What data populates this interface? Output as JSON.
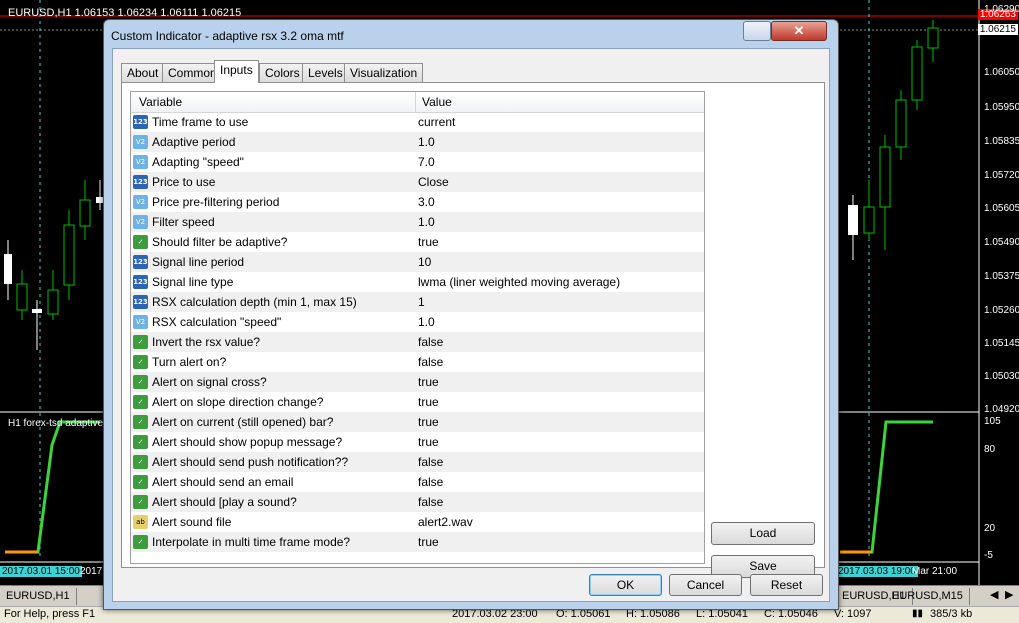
{
  "chart": {
    "symbol_info": "EURUSD,H1  1.06153 1.06234 1.06111 1.06215",
    "subwindow_label": "H1 forex-tsd adaptive",
    "price_axis": [
      "1.06290",
      "1.06215",
      "1.06050",
      "1.05950",
      "1.05835",
      "1.05720",
      "1.05605",
      "1.05490",
      "1.05375",
      "1.05260",
      "1.05145",
      "1.05030",
      "1.04920"
    ],
    "current_price_tag": "1.06263",
    "bid_tag": "1.06215",
    "sub_axis": [
      "105",
      "80",
      "20",
      "-5"
    ],
    "time_labels": [
      "2017.03.01 15:00",
      "2017",
      "2017.03.03 19:00",
      "Mar 21:00"
    ],
    "colors": {
      "bull": "#00c000",
      "bear": "#ffffff",
      "indicator": "#3cd43c",
      "level_line": "#ff9900",
      "grid": "#3bd3d3"
    }
  },
  "chart_tabs": [
    "EURUSD,H1",
    "EURUSD,H1",
    "EURUSD,M15"
  ],
  "status": {
    "help": "For Help, press F1",
    "time": "2017.03.02 23:00",
    "open": "O: 1.05061",
    "high": "H: 1.05086",
    "low": "L: 1.05041",
    "close": "C: 1.05046",
    "volume": "V: 1097",
    "traffic": "385/3 kb"
  },
  "dialog": {
    "title": "Custom Indicator - adaptive rsx 3.2 oma mtf",
    "close_symbol": "✕",
    "tabs": [
      "About",
      "Common",
      "Inputs",
      "Colors",
      "Levels",
      "Visualization"
    ],
    "active_tab": "Inputs",
    "grid_headers": {
      "variable": "Variable",
      "value": "Value"
    },
    "rows": [
      {
        "type": "int",
        "icon": "123",
        "variable": "Time frame to use",
        "value": "current"
      },
      {
        "type": "dbl",
        "icon": "V2",
        "variable": "Adaptive period",
        "value": "1.0"
      },
      {
        "type": "dbl",
        "icon": "V2",
        "variable": "Adapting \"speed\"",
        "value": "7.0"
      },
      {
        "type": "int",
        "icon": "123",
        "variable": "Price to use",
        "value": "Close"
      },
      {
        "type": "dbl",
        "icon": "V2",
        "variable": "Price pre-filtering period",
        "value": "3.0"
      },
      {
        "type": "dbl",
        "icon": "V2",
        "variable": "Filter speed",
        "value": "1.0"
      },
      {
        "type": "bool",
        "icon": "✓",
        "variable": "Should filter be adaptive?",
        "value": "true"
      },
      {
        "type": "int",
        "icon": "123",
        "variable": "Signal line period",
        "value": "10"
      },
      {
        "type": "int",
        "icon": "123",
        "variable": "Signal line type",
        "value": "lwma (liner weighted moving average)"
      },
      {
        "type": "int",
        "icon": "123",
        "variable": "RSX calculation depth (min 1, max 15)",
        "value": "1"
      },
      {
        "type": "dbl",
        "icon": "V2",
        "variable": "RSX calculation \"speed\"",
        "value": "1.0"
      },
      {
        "type": "bool",
        "icon": "✓",
        "variable": "Invert the rsx value?",
        "value": "false"
      },
      {
        "type": "bool",
        "icon": "✓",
        "variable": "Turn alert on?",
        "value": "false"
      },
      {
        "type": "bool",
        "icon": "✓",
        "variable": "Alert on signal cross?",
        "value": "true"
      },
      {
        "type": "bool",
        "icon": "✓",
        "variable": "Alert on slope direction change?",
        "value": "true"
      },
      {
        "type": "bool",
        "icon": "✓",
        "variable": "Alert on current (still opened) bar?",
        "value": "true"
      },
      {
        "type": "bool",
        "icon": "✓",
        "variable": "Alert should show popup message?",
        "value": "true"
      },
      {
        "type": "bool",
        "icon": "✓",
        "variable": "Alert should send push notification??",
        "value": "false"
      },
      {
        "type": "bool",
        "icon": "✓",
        "variable": "Alert should send an email",
        "value": "false"
      },
      {
        "type": "bool",
        "icon": "✓",
        "variable": "Alert should [play a sound?",
        "value": "false"
      },
      {
        "type": "str",
        "icon": "ab",
        "variable": "Alert sound file",
        "value": "alert2.wav"
      },
      {
        "type": "bool",
        "icon": "✓",
        "variable": "Interpolate in multi time frame mode?",
        "value": "true"
      }
    ],
    "side_buttons": {
      "load": "Load",
      "save": "Save"
    },
    "bottom_buttons": {
      "ok": "OK",
      "cancel": "Cancel",
      "reset": "Reset"
    }
  }
}
